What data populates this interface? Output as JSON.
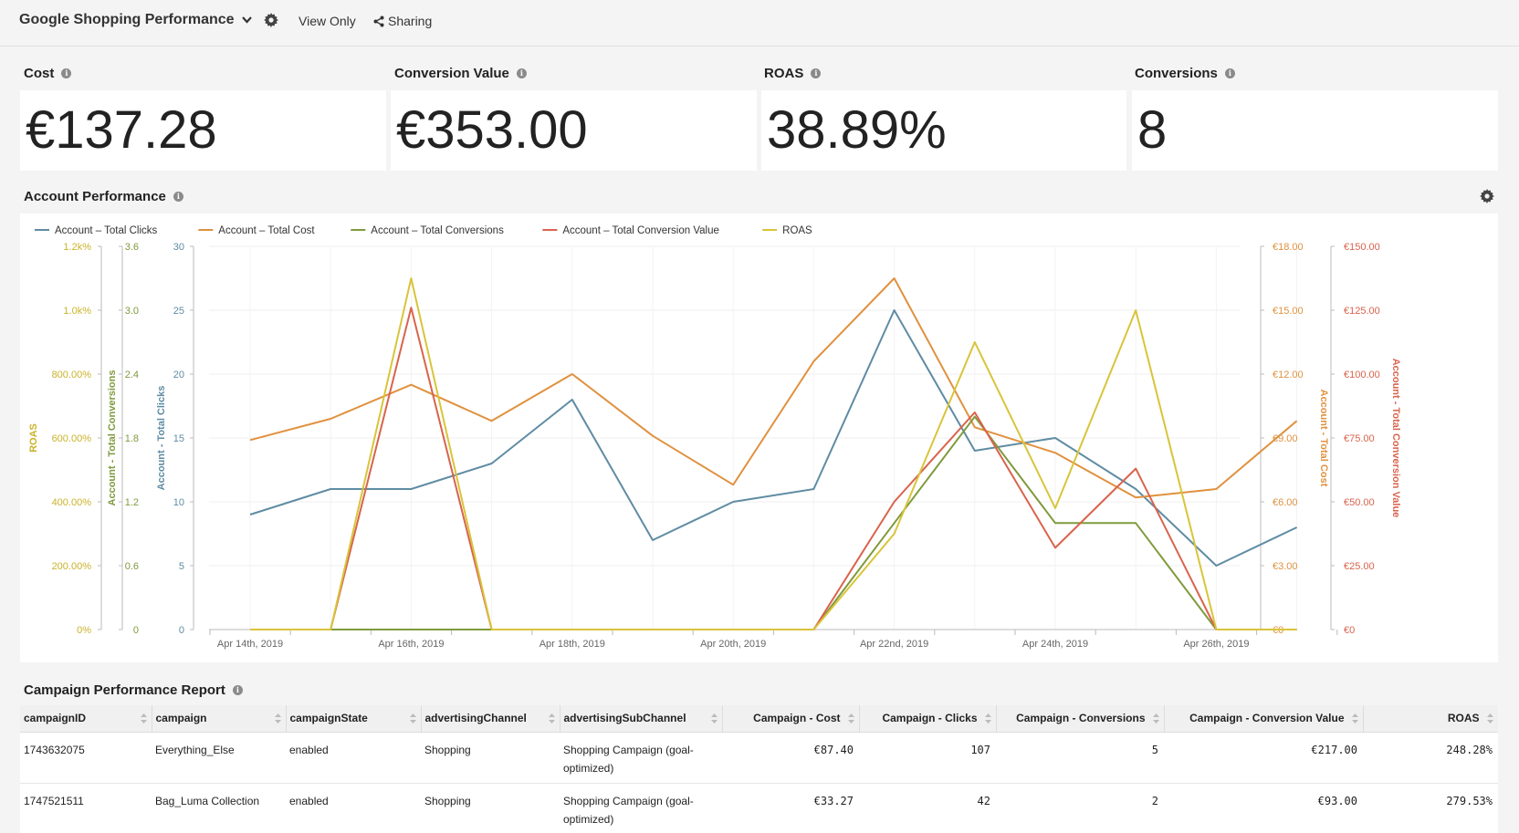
{
  "header": {
    "title": "Google Shopping Performance",
    "view_only": "View Only",
    "sharing": "Sharing"
  },
  "kpis": [
    {
      "label": "Cost",
      "value": "€137.28"
    },
    {
      "label": "Conversion Value",
      "value": "€353.00"
    },
    {
      "label": "ROAS",
      "value": "38.89%"
    },
    {
      "label": "Conversions",
      "value": "8"
    }
  ],
  "chart_section": {
    "title": "Account Performance"
  },
  "chart_data": {
    "type": "line",
    "categories": [
      "Apr 14th, 2019",
      "Apr 15th, 2019",
      "Apr 16th, 2019",
      "Apr 17th, 2019",
      "Apr 18th, 2019",
      "Apr 19th, 2019",
      "Apr 20th, 2019",
      "Apr 21st, 2019",
      "Apr 22nd, 2019",
      "Apr 23rd, 2019",
      "Apr 24th, 2019",
      "Apr 25th, 2019",
      "Apr 26th, 2019",
      "Apr 27th, 2019"
    ],
    "xtick_labels": [
      "Apr 14th, 2019",
      "",
      "Apr 16th, 2019",
      "",
      "Apr 18th, 2019",
      "",
      "Apr 20th, 2019",
      "",
      "Apr 22nd, 2019",
      "",
      "Apr 24th, 2019",
      "",
      "Apr 26th, 2019",
      ""
    ],
    "legend_position": "top-left",
    "grid": true,
    "series": [
      {
        "name": "Account – Total Clicks",
        "color": "#5f8ca3",
        "axis": "clicks",
        "values": [
          9,
          11,
          11,
          13,
          18,
          7,
          10,
          11,
          25,
          14,
          15,
          11,
          5,
          8
        ]
      },
      {
        "name": "Account – Total Cost",
        "color": "#e0913f",
        "axis": "cost",
        "values": [
          8.9,
          9.9,
          11.5,
          9.8,
          12.0,
          9.1,
          6.8,
          12.6,
          16.5,
          9.5,
          8.3,
          6.2,
          6.6,
          9.8
        ]
      },
      {
        "name": "Account – Total Conversions",
        "color": "#7f9a3c",
        "axis": "conversions",
        "values": [
          0,
          0,
          0,
          0,
          0,
          0,
          0,
          0,
          1,
          2,
          1,
          1,
          0,
          0
        ]
      },
      {
        "name": "Account – Total Conversion Value",
        "color": "#d9634c",
        "axis": "convvalue",
        "values": [
          0,
          0,
          126,
          0,
          0,
          0,
          0,
          0,
          50,
          85,
          32,
          63,
          0,
          0
        ]
      },
      {
        "name": "ROAS",
        "color": "#d9c43a",
        "axis": "roas",
        "values": [
          0,
          0,
          1100,
          0,
          0,
          0,
          0,
          0,
          300,
          900,
          380,
          1000,
          0,
          0
        ]
      }
    ],
    "axes": {
      "roas": {
        "label": "ROAS",
        "ticks": [
          "0%",
          "200.00%",
          "400.00%",
          "600.00%",
          "800.00%",
          "1.0k%",
          "1.2k%"
        ],
        "range": [
          0,
          1200
        ],
        "color": "#c9b32a"
      },
      "conversions": {
        "label": "Account - Total Conversions",
        "ticks": [
          "0",
          "0.6",
          "1.2",
          "1.8",
          "2.4",
          "3.0",
          "3.6"
        ],
        "range": [
          0,
          3.6
        ],
        "color": "#7f9a3c"
      },
      "clicks": {
        "label": "Account - Total Clicks",
        "ticks": [
          "0",
          "5",
          "10",
          "15",
          "20",
          "25",
          "30"
        ],
        "range": [
          0,
          30
        ],
        "color": "#5f8ca3"
      },
      "cost": {
        "label": "Account - Total Cost",
        "ticks": [
          "€0",
          "€3.00",
          "€6.00",
          "€9.00",
          "€12.00",
          "€15.00",
          "€18.00"
        ],
        "range": [
          0,
          18
        ],
        "color": "#e0913f"
      },
      "convvalue": {
        "label": "Account - Total Conversion Value",
        "ticks": [
          "€0",
          "€25.00",
          "€50.00",
          "€75.00",
          "€100.00",
          "€125.00",
          "€150.00"
        ],
        "range": [
          0,
          150
        ],
        "color": "#d9634c"
      }
    }
  },
  "table_section": {
    "title": "Campaign Performance Report"
  },
  "table": {
    "columns": [
      "campaignID",
      "campaign",
      "campaignState",
      "advertisingChannel",
      "advertisingSubChannel",
      "Campaign - Cost",
      "Campaign - Clicks",
      "Campaign - Conversions",
      "Campaign - Conversion Value",
      "ROAS"
    ],
    "rows": [
      [
        "1743632075",
        "Everything_Else",
        "enabled",
        "Shopping",
        "Shopping Campaign (goal-optimized)",
        "€87.40",
        "107",
        "5",
        "€217.00",
        "248.28%"
      ],
      [
        "1747521511",
        "Bag_Luma Collection",
        "enabled",
        "Shopping",
        "Shopping Campaign (goal-optimized)",
        "€33.27",
        "42",
        "2",
        "€93.00",
        "279.53%"
      ]
    ]
  }
}
